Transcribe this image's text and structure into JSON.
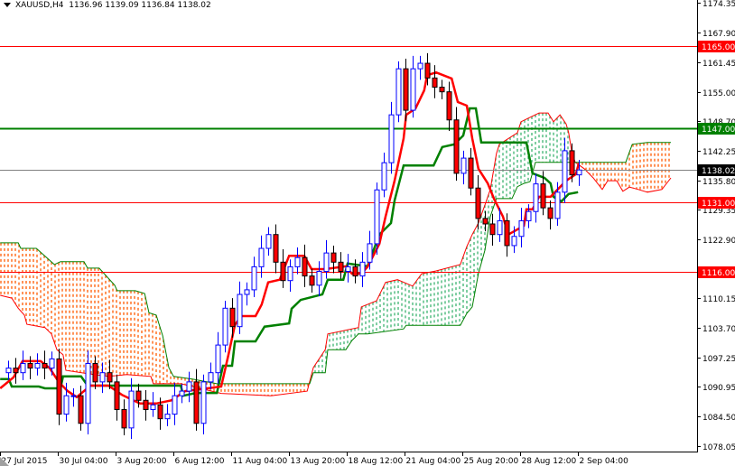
{
  "header": {
    "symbol": "XAUUSD,H4",
    "open": "1136.96",
    "high": "1139.09",
    "low": "1136.84",
    "close": "1138.02"
  },
  "colors": {
    "bull": "#0000ff",
    "bear": "#ff0000",
    "tenkan": "#ff0000",
    "kijun": "#008000",
    "span_a": "#ff0000",
    "span_b": "#008000",
    "cloud_bear": "#ff5a00",
    "cloud_bull": "#3cb371",
    "grid_text": "#000000"
  },
  "chart_data": {
    "type": "candlestick",
    "title": "XAUUSD,H4",
    "ylim": [
      1078.05,
      1174.35
    ],
    "y_ticks": [
      "1174.35",
      "1167.90",
      "1161.45",
      "1155.00",
      "1148.70",
      "1142.25",
      "1135.80",
      "1129.35",
      "1122.90",
      "1110.15",
      "1103.70",
      "1097.25",
      "1090.95",
      "1084.50",
      "1078.05"
    ],
    "x_ticks": [
      {
        "bar": -1.1,
        "label": "27 Jul 2015"
      },
      {
        "bar": 6.9,
        "label": "30 Jul 04:00"
      },
      {
        "bar": 14.9,
        "label": "3 Aug 20:00"
      },
      {
        "bar": 22.9,
        "label": "6 Aug 12:00"
      },
      {
        "bar": 30.9,
        "label": "11 Aug 04:00"
      },
      {
        "bar": 38.9,
        "label": "13 Aug 20:00"
      },
      {
        "bar": 46.9,
        "label": "18 Aug 12:00"
      },
      {
        "bar": 54.9,
        "label": "21 Aug 04:00"
      },
      {
        "bar": 62.9,
        "label": "25 Aug 20:00"
      },
      {
        "bar": 70.9,
        "label": "28 Aug 12:00"
      },
      {
        "bar": 78.9,
        "label": "2 Sep 04:00"
      }
    ],
    "first_open": 1094,
    "closes": [
      1095,
      1094,
      1096,
      1095,
      1096,
      1095,
      1097,
      1085,
      1089,
      1089,
      1083,
      1096,
      1092,
      1094,
      1092,
      1086,
      1082,
      1090,
      1088,
      1086,
      1087,
      1084,
      1085,
      1089,
      1090,
      1092,
      1083,
      1092,
      1094,
      1100,
      1108,
      1104,
      1111,
      1112,
      1117,
      1121,
      1124,
      1118,
      1114,
      1117,
      1119,
      1115,
      1113,
      1116,
      1120,
      1118,
      1116,
      1117,
      1115,
      1118,
      1122,
      1133.7,
      1139.6,
      1150,
      1160,
      1151,
      1160,
      1161.2,
      1158,
      1156,
      1155,
      1148.9,
      1137.3,
      1140.6,
      1134.1,
      1127.5,
      1126.3,
      1124,
      1127,
      1121.6,
      1123.6,
      1127,
      1129,
      1135,
      1129.8,
      1127.5,
      1133.2,
      1142.2,
      1136.96,
      1138.02
    ],
    "tenkan": [
      [
        -1.1,
        1090.6
      ],
      [
        0.75,
        1093
      ],
      [
        2,
        1096.5
      ],
      [
        4.5,
        1096.5
      ],
      [
        5.75,
        1095
      ],
      [
        7,
        1092
      ],
      [
        8.25,
        1090
      ],
      [
        9.5,
        1088.7
      ],
      [
        11.4,
        1091.2
      ],
      [
        13.9,
        1091.2
      ],
      [
        15.75,
        1089.2
      ],
      [
        18.25,
        1087.3
      ],
      [
        20.5,
        1087.3
      ],
      [
        22.6,
        1088
      ],
      [
        24.5,
        1090
      ],
      [
        27.6,
        1090.6
      ],
      [
        29.5,
        1091
      ],
      [
        30.5,
        1097.9
      ],
      [
        31.4,
        1104.4
      ],
      [
        32.25,
        1106.3
      ],
      [
        34.25,
        1106.3
      ],
      [
        35.1,
        1108.8
      ],
      [
        36,
        1113.6
      ],
      [
        37.6,
        1114.2
      ],
      [
        38.9,
        1119.4
      ],
      [
        41,
        1119.4
      ],
      [
        42,
        1116.5
      ],
      [
        43.9,
        1116.5
      ],
      [
        46.75,
        1117.1
      ],
      [
        47.6,
        1115.5
      ],
      [
        48.9,
        1115.5
      ],
      [
        49.75,
        1117
      ],
      [
        51.4,
        1122
      ],
      [
        52.25,
        1127.9
      ],
      [
        53.5,
        1135.7
      ],
      [
        54.75,
        1144.9
      ],
      [
        55.1,
        1150
      ],
      [
        56.4,
        1151.4
      ],
      [
        57.6,
        1155.3
      ],
      [
        58,
        1158.6
      ],
      [
        59.25,
        1159.2
      ],
      [
        61.4,
        1157.9
      ],
      [
        62.25,
        1152.8
      ],
      [
        63.5,
        1152
      ],
      [
        64.25,
        1144.9
      ],
      [
        65.1,
        1138.3
      ],
      [
        66.4,
        1135.1
      ],
      [
        67.25,
        1131.8
      ],
      [
        68.5,
        1127.9
      ],
      [
        69.25,
        1124
      ],
      [
        71.4,
        1125.9
      ],
      [
        71.75,
        1129.5
      ],
      [
        72.6,
        1129.5
      ],
      [
        73.5,
        1132.2
      ],
      [
        75.1,
        1132.2
      ],
      [
        77.25,
        1135.7
      ],
      [
        78.6,
        1137.1
      ],
      [
        79,
        1139.5
      ]
    ],
    "kijun": [
      [
        -1.1,
        1092.6
      ],
      [
        0.1,
        1092.6
      ],
      [
        0.5,
        1091
      ],
      [
        4.25,
        1091
      ],
      [
        5.1,
        1090.6
      ],
      [
        7.25,
        1090.6
      ],
      [
        7.6,
        1093.2
      ],
      [
        10.1,
        1093.2
      ],
      [
        11,
        1091.2
      ],
      [
        23.9,
        1091.2
      ],
      [
        24.25,
        1089
      ],
      [
        26,
        1089.6
      ],
      [
        28.9,
        1089.6
      ],
      [
        29.75,
        1095.5
      ],
      [
        31,
        1095.5
      ],
      [
        31.4,
        1100.8
      ],
      [
        34.25,
        1100.8
      ],
      [
        35.5,
        1104
      ],
      [
        38.9,
        1104.7
      ],
      [
        39.25,
        1107.9
      ],
      [
        40.5,
        1109.8
      ],
      [
        43.5,
        1111
      ],
      [
        44.25,
        1114.2
      ],
      [
        46.4,
        1114.2
      ],
      [
        47,
        1117.7
      ],
      [
        49.75,
        1117.1
      ],
      [
        51.4,
        1124
      ],
      [
        53,
        1126.5
      ],
      [
        53.5,
        1131.4
      ],
      [
        54.75,
        1139
      ],
      [
        58.9,
        1139
      ],
      [
        60.1,
        1143
      ],
      [
        61.75,
        1143.6
      ],
      [
        63,
        1145.5
      ],
      [
        63.9,
        1151.4
      ],
      [
        64.75,
        1151.4
      ],
      [
        65.5,
        1144
      ],
      [
        71.75,
        1144
      ],
      [
        72.6,
        1137.3
      ],
      [
        74.25,
        1136.3
      ],
      [
        75.1,
        1135.1
      ],
      [
        75.5,
        1132.2
      ],
      [
        76.6,
        1131.2
      ],
      [
        77.6,
        1132.8
      ],
      [
        78.9,
        1133.2
      ]
    ],
    "span_a": [
      [
        -1.1,
        1110.8
      ],
      [
        0.5,
        1110.2
      ],
      [
        1.4,
        1108
      ],
      [
        2.25,
        1106.5
      ],
      [
        2.6,
        1104.5
      ],
      [
        5.1,
        1103.8
      ],
      [
        6,
        1102.4
      ],
      [
        6.75,
        1099
      ],
      [
        7.6,
        1097.9
      ],
      [
        8,
        1094.5
      ],
      [
        11,
        1093.8
      ],
      [
        13.9,
        1093.2
      ],
      [
        16.4,
        1093.6
      ],
      [
        19.75,
        1093.2
      ],
      [
        20.1,
        1091.6
      ],
      [
        23.9,
        1091.6
      ],
      [
        29.5,
        1089.5
      ],
      [
        36.4,
        1089
      ],
      [
        41.4,
        1090
      ],
      [
        42.25,
        1095.1
      ],
      [
        43.9,
        1099
      ],
      [
        44.25,
        1102.4
      ],
      [
        48.5,
        1103.8
      ],
      [
        48.9,
        1108.3
      ],
      [
        51,
        1109.6
      ],
      [
        52.25,
        1113.6
      ],
      [
        53.9,
        1114.2
      ],
      [
        56,
        1112.8
      ],
      [
        57.25,
        1115.5
      ],
      [
        59.25,
        1116.1
      ],
      [
        62.6,
        1117.5
      ],
      [
        63.5,
        1121.4
      ],
      [
        64.25,
        1124
      ],
      [
        65.1,
        1126.5
      ],
      [
        66,
        1130.4
      ],
      [
        66.75,
        1133.8
      ],
      [
        67.6,
        1141.6
      ],
      [
        68,
        1143.6
      ],
      [
        70.5,
        1146.1
      ],
      [
        71,
        1148.5
      ],
      [
        73.5,
        1150.4
      ],
      [
        74.75,
        1150.4
      ],
      [
        75.5,
        1148.5
      ],
      [
        76.4,
        1150
      ],
      [
        77.25,
        1148
      ],
      [
        77.6,
        1146.1
      ],
      [
        78,
        1142.2
      ],
      [
        78.5,
        1139.7
      ],
      [
        79.75,
        1138.3
      ],
      [
        81,
        1136.3
      ],
      [
        82.25,
        1133.8
      ],
      [
        83,
        1135.7
      ],
      [
        84.25,
        1135.7
      ],
      [
        85.1,
        1133.4
      ],
      [
        86,
        1134.3
      ],
      [
        87.25,
        1133.8
      ],
      [
        88.5,
        1133.2
      ],
      [
        90.5,
        1133.8
      ],
      [
        91.75,
        1136.3
      ]
    ],
    "span_b": [
      [
        -1.1,
        1122.2
      ],
      [
        1.4,
        1122.2
      ],
      [
        1.75,
        1121
      ],
      [
        3.9,
        1121
      ],
      [
        6.4,
        1117.5
      ],
      [
        7.25,
        1118.1
      ],
      [
        10.5,
        1118.1
      ],
      [
        11,
        1116.7
      ],
      [
        12.6,
        1116.7
      ],
      [
        14.75,
        1113
      ],
      [
        15.1,
        1111.8
      ],
      [
        17.6,
        1111.8
      ],
      [
        18.9,
        1111.2
      ],
      [
        19.5,
        1107
      ],
      [
        20.5,
        1106.5
      ],
      [
        21.4,
        1102
      ],
      [
        22.25,
        1095.1
      ],
      [
        22.9,
        1093.2
      ],
      [
        25.5,
        1092.6
      ],
      [
        28.9,
        1091.6
      ],
      [
        41.75,
        1091.6
      ],
      [
        42.25,
        1094
      ],
      [
        43.9,
        1094
      ],
      [
        44.25,
        1099
      ],
      [
        46.75,
        1099
      ],
      [
        47.6,
        1101
      ],
      [
        48.5,
        1102.4
      ],
      [
        49.75,
        1102.4
      ],
      [
        54.75,
        1103.5
      ],
      [
        55.1,
        1104.3
      ],
      [
        62.6,
        1104.3
      ],
      [
        63.5,
        1106.9
      ],
      [
        64.25,
        1108.3
      ],
      [
        65.1,
        1115.5
      ],
      [
        66,
        1120.6
      ],
      [
        66.75,
        1127.9
      ],
      [
        67.6,
        1131.8
      ],
      [
        69.75,
        1131.8
      ],
      [
        70.5,
        1134.4
      ],
      [
        71.4,
        1135.1
      ],
      [
        72.25,
        1135.5
      ],
      [
        73,
        1139.7
      ],
      [
        85.5,
        1139.7
      ],
      [
        86.4,
        1143.6
      ],
      [
        88.5,
        1144
      ],
      [
        91.75,
        1144
      ]
    ],
    "levels": [
      {
        "price": 1165.0,
        "label": "1165.00",
        "color": "#ff0000",
        "label_bg": "#ff0000"
      },
      {
        "price": 1147.0,
        "label": "1147.00",
        "color": "#008000",
        "label_bg": "#008000"
      },
      {
        "price": 1138.02,
        "label": "1138.02",
        "color": "#808080",
        "label_bg": "#000000"
      },
      {
        "price": 1131.0,
        "label": "1131.00",
        "color": "#ff0000",
        "label_bg": "#ff0000"
      },
      {
        "price": 1116.0,
        "label": "1116.00",
        "color": "#ff0000",
        "label_bg": "#ff0000"
      }
    ]
  }
}
